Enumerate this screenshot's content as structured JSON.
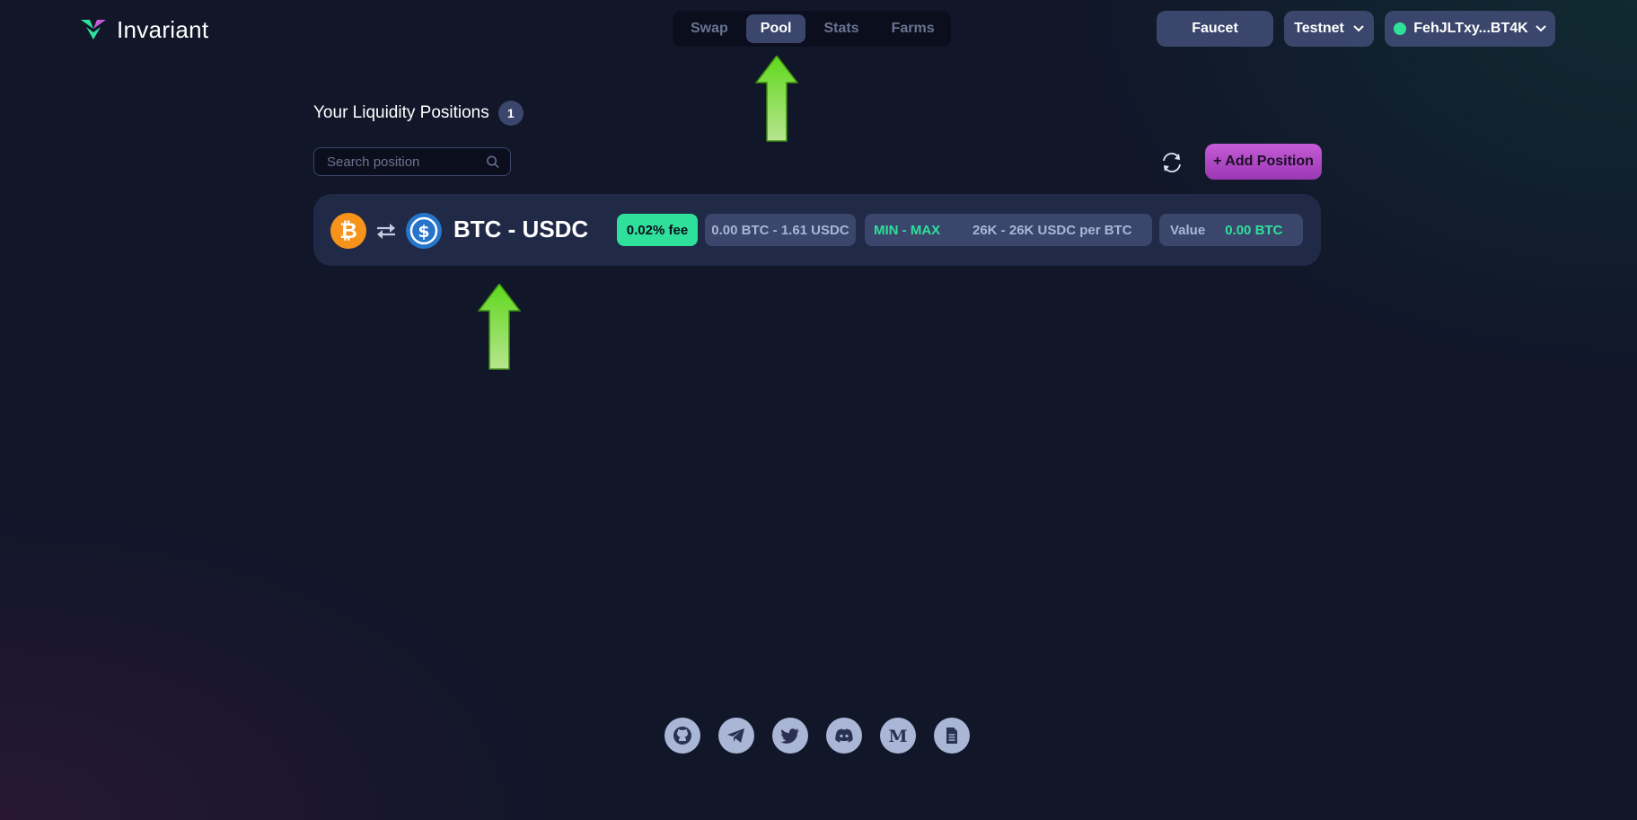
{
  "brand": {
    "name": "Invariant"
  },
  "nav": {
    "tabs": [
      "Swap",
      "Pool",
      "Stats",
      "Farms"
    ],
    "active": "Pool"
  },
  "header": {
    "faucet_label": "Faucet",
    "network_label": "Testnet",
    "wallet_label": "FehJLTxy...BT4K",
    "wallet_status_color": "#2ee09a"
  },
  "positions": {
    "title": "Your Liquidity Positions",
    "count": "1",
    "search_placeholder": "Search position",
    "add_button": "+ Add Position",
    "items": [
      {
        "pair": "BTC - USDC",
        "token_a_icon": "btc-icon",
        "token_b_icon": "usdc-icon",
        "fee": "0.02% fee",
        "amounts": "0.00 BTC - 1.61 USDC",
        "range_label": "MIN - MAX",
        "range_value": "26K - 26K USDC per BTC",
        "value_label": "Value",
        "value": "0.00 BTC"
      }
    ]
  },
  "footer": {
    "socials": [
      "github-icon",
      "telegram-icon",
      "twitter-icon",
      "discord-icon",
      "medium-icon",
      "docs-icon"
    ]
  },
  "colors": {
    "accent_green": "#2ee09a",
    "accent_purple": "#c65bd6",
    "pill_bg": "#3a466b",
    "row_bg": "#202946"
  }
}
